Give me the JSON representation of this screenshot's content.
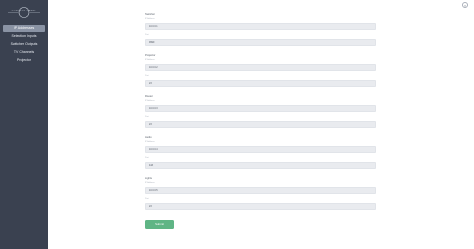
{
  "app": {
    "logo_text": "CONTROL PANEL"
  },
  "sidebar": {
    "items": [
      {
        "label": "IP Addresses",
        "active": true
      },
      {
        "label": "Selection Inputs",
        "active": false
      },
      {
        "label": "Switcher Outputs",
        "active": false
      },
      {
        "label": "TV Channels",
        "active": false
      },
      {
        "label": "Projector",
        "active": false
      }
    ]
  },
  "header": {
    "corner_icon": "close-icon",
    "corner_glyph": "×"
  },
  "form": {
    "sections": [
      {
        "title": "Switcher",
        "ip_label": "IP Address",
        "ip_value": "10.0.0.1",
        "port_label": "Port",
        "port_value": "9999"
      },
      {
        "title": "Projector",
        "ip_label": "IP Address",
        "ip_value": "10.0.0.2",
        "port_label": "Port",
        "port_value": "23"
      },
      {
        "title": "Router",
        "ip_label": "IP Address",
        "ip_value": "10.0.0.3",
        "port_label": "Port",
        "port_value": "23"
      },
      {
        "title": "Audio",
        "ip_label": "IP Address",
        "ip_value": "10.0.0.4",
        "port_label": "Port",
        "port_value": "443"
      },
      {
        "title": "Lights",
        "ip_label": "IP Address",
        "ip_value": "10.0.0.5",
        "port_label": "Port",
        "port_value": "23"
      }
    ],
    "submit_label": "Submit"
  },
  "colors": {
    "sidebar_bg": "#3a4150",
    "active_item_bg": "#8a93a4",
    "submit_bg": "#5fb585"
  }
}
